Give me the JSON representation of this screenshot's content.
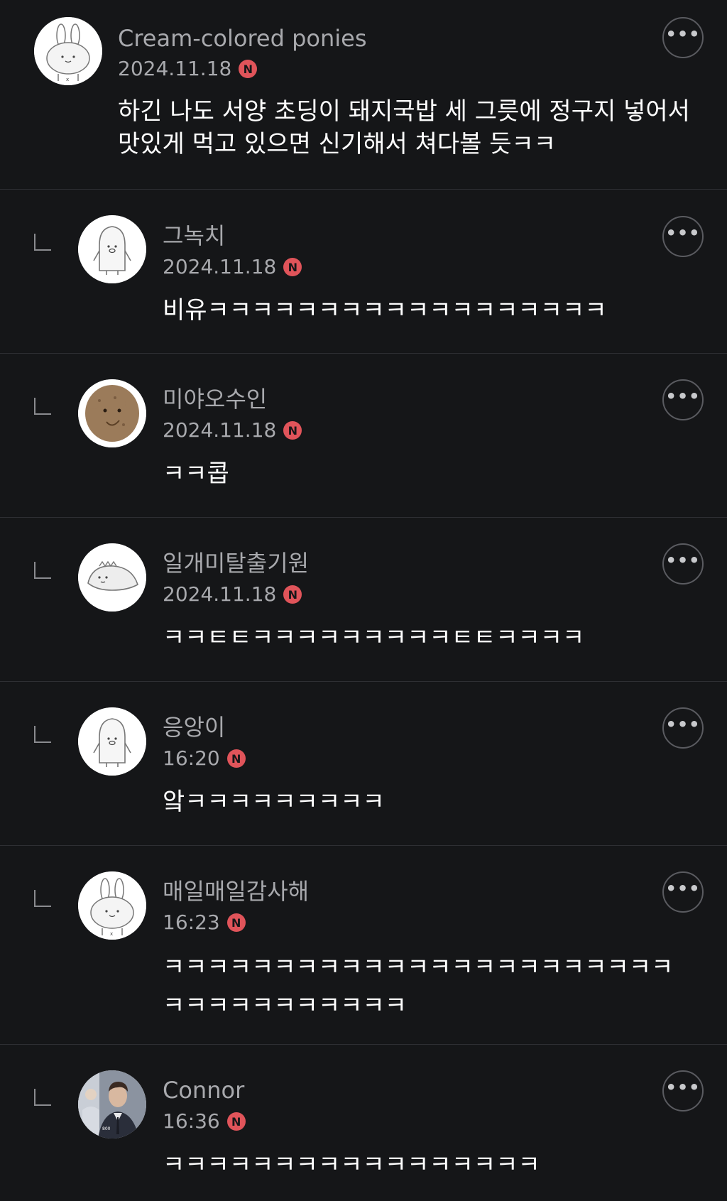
{
  "colors": {
    "badge": "#e0545a",
    "background": "#151618",
    "divider": "#2e2f33"
  },
  "comments": [
    {
      "author": "Cream-colored ponies",
      "date": "2024.11.18",
      "badge": "N",
      "text": "하긴 나도 서양 초딩이 돼지국밥 세 그릇에 정구지 넣어서 맛있게 먹고 있으면 신기해서 쳐다볼 듯ㅋㅋ",
      "avatar": "rabbit-icon",
      "more_label": "•••"
    },
    {
      "author": "그녹치",
      "date": "2024.11.18",
      "badge": "N",
      "text": "비유ㅋㅋㅋㅋㅋㅋㅋㅋㅋㅋㅋㅋㅋㅋㅋㅋㅋㅋ",
      "avatar": "penguin-icon",
      "more_label": "•••"
    },
    {
      "author": "미야오수인",
      "date": "2024.11.18",
      "badge": "N",
      "text": "ㅋㅋ콥",
      "avatar": "brown-creature-icon",
      "more_label": "•••"
    },
    {
      "author": "일개미탈출기원",
      "date": "2024.11.18",
      "badge": "N",
      "text": "ㅋㅋㅌㅌㅋㅋㅋㅋㅋㅋㅋㅋㅋㅌㅌㅋㅋㅋㅋ",
      "avatar": "dinosaur-icon",
      "more_label": "•••"
    },
    {
      "author": "응앙이",
      "date": "16:20",
      "badge": "N",
      "text": "앜ㅋㅋㅋㅋㅋㅋㅋㅋㅋ",
      "avatar": "penguin-icon",
      "more_label": "•••"
    },
    {
      "author": "매일매일감사해",
      "date": "16:23",
      "badge": "N",
      "text": "ㅋㅋㅋㅋㅋㅋㅋㅋㅋㅋㅋㅋㅋㅋㅋㅋㅋㅋㅋㅋㅋㅋㅋㅋㅋㅋㅋㅋㅋㅋㅋㅋㅋㅋ",
      "avatar": "rabbit-icon",
      "more_label": "•••"
    },
    {
      "author": "Connor",
      "date": "16:36",
      "badge": "N",
      "text": "ㅋㅋㅋㅋㅋㅋㅋㅋㅋㅋㅋㅋㅋㅋㅋㅋㅋ",
      "avatar": "portrait-photo",
      "more_label": "•••"
    }
  ]
}
